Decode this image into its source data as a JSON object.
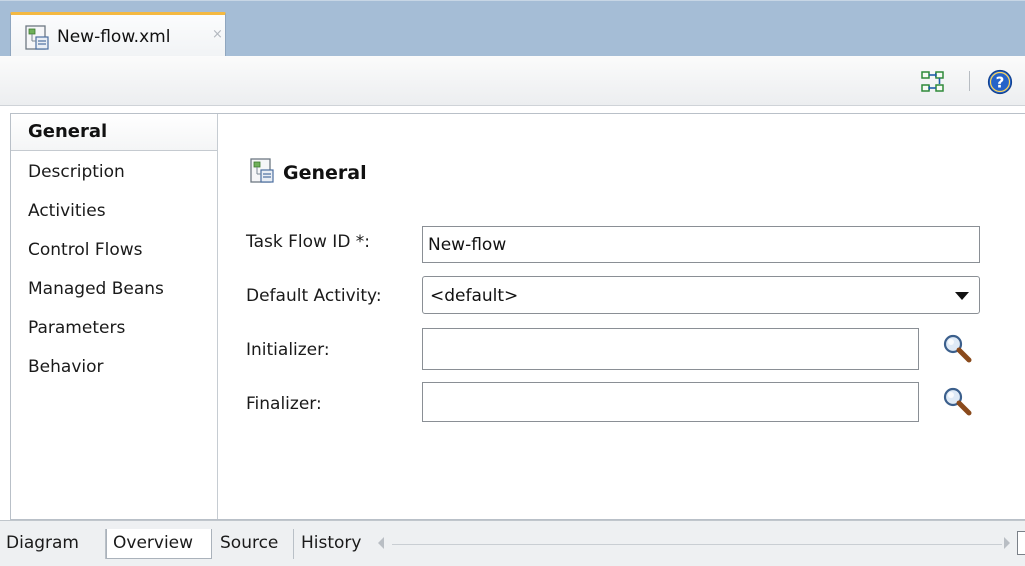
{
  "editor_tab": {
    "title": "New-flow.xml",
    "close_glyph": "×",
    "icon": "task-flow-file-icon"
  },
  "toolbar": {
    "icons": [
      "flow-diagram-icon",
      "help-icon"
    ],
    "help_glyph": "?"
  },
  "sidebar": {
    "selected": "General",
    "items": [
      {
        "label": "General"
      },
      {
        "label": "Description"
      },
      {
        "label": "Activities"
      },
      {
        "label": "Control Flows"
      },
      {
        "label": "Managed Beans"
      },
      {
        "label": "Parameters"
      },
      {
        "label": "Behavior"
      }
    ]
  },
  "section": {
    "title": "General",
    "icon": "task-flow-file-icon"
  },
  "form": {
    "task_flow_id": {
      "label": "Task Flow ID *:",
      "value": "New-flow"
    },
    "default_activity": {
      "label": "Default Activity:",
      "value": "<default>"
    },
    "initializer": {
      "label": "Initializer:",
      "value": "",
      "button_icon": "search-icon"
    },
    "finalizer": {
      "label": "Finalizer:",
      "value": "",
      "button_icon": "search-icon"
    }
  },
  "bottom_tabs": [
    {
      "label": "Diagram"
    },
    {
      "label": "Overview",
      "active": true
    },
    {
      "label": "Source"
    },
    {
      "label": "History"
    }
  ],
  "colors": {
    "tab_accent": "#f4b942",
    "tabstrip_bg": "#a5bdd6",
    "help_blue": "#2563c9"
  }
}
